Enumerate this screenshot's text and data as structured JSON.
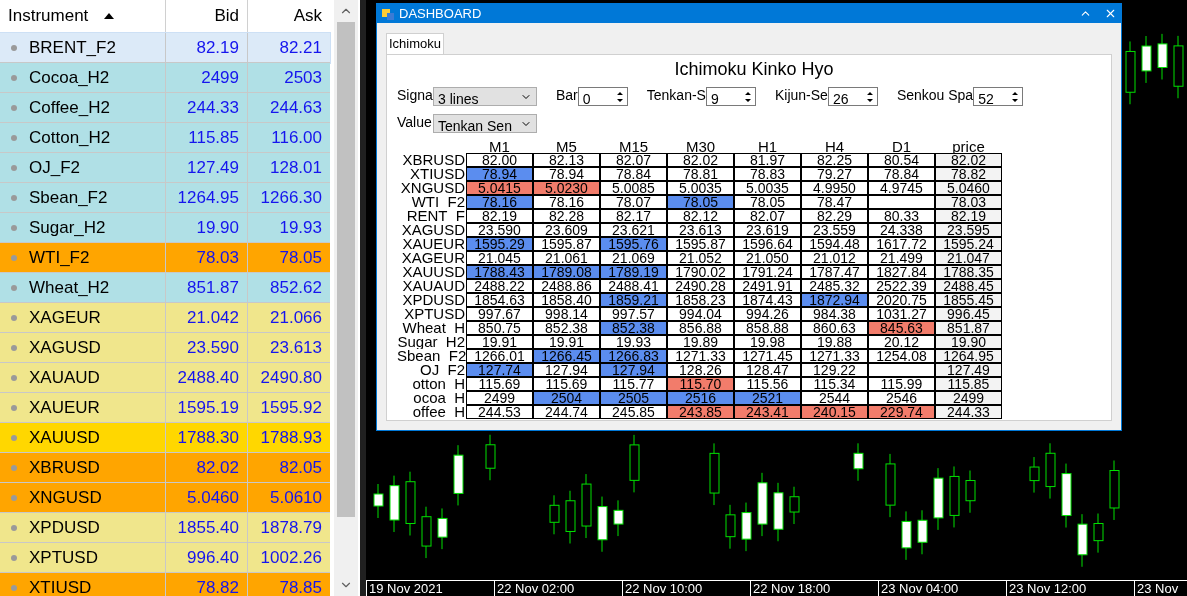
{
  "watchlist": {
    "columns": [
      "Instrument",
      "Bid",
      "Ask"
    ],
    "rows": [
      {
        "name": "BRENT_F2",
        "bid": "82.19",
        "ask": "82.21",
        "color": "#dceaf8",
        "selected": true
      },
      {
        "name": "Cocoa_H2",
        "bid": "2499",
        "ask": "2503",
        "color": "#b0e0e6",
        "selected": false
      },
      {
        "name": "Coffee_H2",
        "bid": "244.33",
        "ask": "244.63",
        "color": "#b0e0e6",
        "selected": false
      },
      {
        "name": "Cotton_H2",
        "bid": "115.85",
        "ask": "116.00",
        "color": "#b0e0e6",
        "selected": false
      },
      {
        "name": "OJ_F2",
        "bid": "127.49",
        "ask": "128.01",
        "color": "#b0e0e6",
        "selected": false
      },
      {
        "name": "Sbean_F2",
        "bid": "1264.95",
        "ask": "1266.30",
        "color": "#b0e0e6",
        "selected": false
      },
      {
        "name": "Sugar_H2",
        "bid": "19.90",
        "ask": "19.93",
        "color": "#b0e0e6",
        "selected": false
      },
      {
        "name": "WTI_F2",
        "bid": "78.03",
        "ask": "78.05",
        "color": "#ffa500",
        "selected": false
      },
      {
        "name": "Wheat_H2",
        "bid": "851.87",
        "ask": "852.62",
        "color": "#b0e0e6",
        "selected": false
      },
      {
        "name": "XAGEUR",
        "bid": "21.042",
        "ask": "21.066",
        "color": "#f0e68c",
        "selected": false
      },
      {
        "name": "XAGUSD",
        "bid": "23.590",
        "ask": "23.613",
        "color": "#f0e68c",
        "selected": false
      },
      {
        "name": "XAUAUD",
        "bid": "2488.40",
        "ask": "2490.80",
        "color": "#f0e68c",
        "selected": false
      },
      {
        "name": "XAUEUR",
        "bid": "1595.19",
        "ask": "1595.92",
        "color": "#f0e68c",
        "selected": false
      },
      {
        "name": "XAUUSD",
        "bid": "1788.30",
        "ask": "1788.93",
        "color": "#ffd700",
        "selected": false
      },
      {
        "name": "XBRUSD",
        "bid": "82.02",
        "ask": "82.05",
        "color": "#ffa500",
        "selected": false
      },
      {
        "name": "XNGUSD",
        "bid": "5.0460",
        "ask": "5.0610",
        "color": "#ffa500",
        "selected": false
      },
      {
        "name": "XPDUSD",
        "bid": "1855.40",
        "ask": "1878.79",
        "color": "#f0e68c",
        "selected": false
      },
      {
        "name": "XPTUSD",
        "bid": "996.40",
        "ask": "1002.26",
        "color": "#f0e68c",
        "selected": false
      },
      {
        "name": "XTIUSD",
        "bid": "78.82",
        "ask": "78.85",
        "color": "#ffa500",
        "selected": false
      }
    ]
  },
  "chart": {
    "time_labels": [
      "19 Nov 2021",
      "22 Nov 02:00",
      "22 Nov 10:00",
      "22 Nov 18:00",
      "23 Nov 04:00",
      "23 Nov 12:00",
      "23 Nov"
    ]
  },
  "dashboard": {
    "title": "DASHBOARD",
    "tabs": [
      {
        "label": "Ichimoku",
        "selected": true
      }
    ],
    "heading": "Ichimoku Kinko Hyo",
    "control_rows": [
      {
        "controls": [
          {
            "kind": "dropdown",
            "label": "Signa",
            "value": "3 lines"
          },
          {
            "kind": "spinner",
            "label": "Bar",
            "value": "0"
          },
          {
            "kind": "spinner",
            "label": "Tenkan-S",
            "value": "9"
          },
          {
            "kind": "spinner",
            "label": "Kijun-Se",
            "value": "26"
          },
          {
            "kind": "spinner",
            "label": "Senkou Spa",
            "value": "52"
          }
        ]
      },
      {
        "controls": [
          {
            "kind": "dropdown",
            "label": "Value",
            "value": "Tenkan Sen"
          }
        ]
      }
    ],
    "table": {
      "columns": [
        "M1",
        "M5",
        "M15",
        "M30",
        "H1",
        "H4",
        "D1",
        "price"
      ],
      "rows": [
        {
          "name": "XBRUSD",
          "cells": [
            {
              "text": "82.00"
            },
            {
              "text": "82.13"
            },
            {
              "text": "82.07"
            },
            {
              "text": "82.02"
            },
            {
              "text": "81.97"
            },
            {
              "text": "82.25"
            },
            {
              "text": "80.54"
            },
            {
              "text": "82.02"
            }
          ]
        },
        {
          "name": "XTIUSD",
          "cells": [
            {
              "text": "78.94",
              "color": "#5b8def"
            },
            {
              "text": "78.94"
            },
            {
              "text": "78.84"
            },
            {
              "text": "78.81"
            },
            {
              "text": "78.83"
            },
            {
              "text": "79.27"
            },
            {
              "text": "78.84"
            },
            {
              "text": "78.82"
            }
          ]
        },
        {
          "name": "XNGUSD",
          "cells": [
            {
              "text": "5.0415",
              "color": "#f27c6b"
            },
            {
              "text": "5.0230",
              "color": "#f27c6b"
            },
            {
              "text": "5.0085"
            },
            {
              "text": "5.0035"
            },
            {
              "text": "5.0035"
            },
            {
              "text": "4.9950"
            },
            {
              "text": "4.9745"
            },
            {
              "text": "5.0460"
            }
          ]
        },
        {
          "name": "WTI_F2",
          "cells": [
            {
              "text": "78.16",
              "color": "#5b8def"
            },
            {
              "text": "78.16"
            },
            {
              "text": "78.07"
            },
            {
              "text": "78.05",
              "color": "#5b8def"
            },
            {
              "text": "78.05"
            },
            {
              "text": "78.47"
            },
            {
              "text": ""
            },
            {
              "text": "78.03"
            }
          ]
        },
        {
          "name": "RENT_F",
          "cells": [
            {
              "text": "82.19"
            },
            {
              "text": "82.28"
            },
            {
              "text": "82.17"
            },
            {
              "text": "82.12"
            },
            {
              "text": "82.07"
            },
            {
              "text": "82.29"
            },
            {
              "text": "80.33"
            },
            {
              "text": "82.19"
            }
          ]
        },
        {
          "name": "XAGUSD",
          "cells": [
            {
              "text": "23.590"
            },
            {
              "text": "23.609"
            },
            {
              "text": "23.621"
            },
            {
              "text": "23.613"
            },
            {
              "text": "23.619"
            },
            {
              "text": "23.559"
            },
            {
              "text": "24.338"
            },
            {
              "text": "23.595"
            }
          ]
        },
        {
          "name": "XAUEUR",
          "cells": [
            {
              "text": "1595.29",
              "color": "#5b8def"
            },
            {
              "text": "1595.87"
            },
            {
              "text": "1595.76",
              "color": "#5b8def"
            },
            {
              "text": "1595.87"
            },
            {
              "text": "1596.64"
            },
            {
              "text": "1594.48"
            },
            {
              "text": "1617.72"
            },
            {
              "text": "1595.24"
            }
          ]
        },
        {
          "name": "XAGEUR",
          "cells": [
            {
              "text": "21.045"
            },
            {
              "text": "21.061"
            },
            {
              "text": "21.069"
            },
            {
              "text": "21.052"
            },
            {
              "text": "21.050"
            },
            {
              "text": "21.012"
            },
            {
              "text": "21.499"
            },
            {
              "text": "21.047"
            }
          ]
        },
        {
          "name": "XAUUSD",
          "cells": [
            {
              "text": "1788.43",
              "color": "#5b8def"
            },
            {
              "text": "1789.08",
              "color": "#5b8def"
            },
            {
              "text": "1789.19",
              "color": "#5b8def"
            },
            {
              "text": "1790.02"
            },
            {
              "text": "1791.24"
            },
            {
              "text": "1787.47"
            },
            {
              "text": "1827.84"
            },
            {
              "text": "1788.35"
            }
          ]
        },
        {
          "name": "XAUAUD",
          "cells": [
            {
              "text": "2488.22"
            },
            {
              "text": "2488.86"
            },
            {
              "text": "2488.41"
            },
            {
              "text": "2490.28"
            },
            {
              "text": "2491.91"
            },
            {
              "text": "2485.32"
            },
            {
              "text": "2522.39"
            },
            {
              "text": "2488.45"
            }
          ]
        },
        {
          "name": "XPDUSD",
          "cells": [
            {
              "text": "1854.63"
            },
            {
              "text": "1858.40"
            },
            {
              "text": "1859.21",
              "color": "#5b8def"
            },
            {
              "text": "1858.23"
            },
            {
              "text": "1874.43"
            },
            {
              "text": "1872.94",
              "color": "#5b8def"
            },
            {
              "text": "2020.75"
            },
            {
              "text": "1855.45"
            }
          ]
        },
        {
          "name": "XPTUSD",
          "cells": [
            {
              "text": "997.67"
            },
            {
              "text": "998.14"
            },
            {
              "text": "997.57"
            },
            {
              "text": "994.04"
            },
            {
              "text": "994.26"
            },
            {
              "text": "984.38"
            },
            {
              "text": "1031.27"
            },
            {
              "text": "996.45"
            }
          ]
        },
        {
          "name": "Wheat_H",
          "cells": [
            {
              "text": "850.75"
            },
            {
              "text": "852.38"
            },
            {
              "text": "852.38",
              "color": "#5b8def"
            },
            {
              "text": "856.88"
            },
            {
              "text": "858.88"
            },
            {
              "text": "860.63"
            },
            {
              "text": "845.63",
              "color": "#f27c6b"
            },
            {
              "text": "851.87"
            }
          ]
        },
        {
          "name": "Sugar_H2",
          "cells": [
            {
              "text": "19.91"
            },
            {
              "text": "19.91"
            },
            {
              "text": "19.93"
            },
            {
              "text": "19.89"
            },
            {
              "text": "19.98"
            },
            {
              "text": "19.88"
            },
            {
              "text": "20.12"
            },
            {
              "text": "19.90"
            }
          ]
        },
        {
          "name": "Sbean_F2",
          "cells": [
            {
              "text": "1266.01"
            },
            {
              "text": "1266.45",
              "color": "#5b8def"
            },
            {
              "text": "1266.83",
              "color": "#5b8def"
            },
            {
              "text": "1271.33"
            },
            {
              "text": "1271.45"
            },
            {
              "text": "1271.33"
            },
            {
              "text": "1254.08"
            },
            {
              "text": "1264.95"
            }
          ]
        },
        {
          "name": "OJ_F2",
          "cells": [
            {
              "text": "127.74",
              "color": "#5b8def"
            },
            {
              "text": "127.94"
            },
            {
              "text": "127.94",
              "color": "#5b8def"
            },
            {
              "text": "128.26"
            },
            {
              "text": "128.47"
            },
            {
              "text": "129.22"
            },
            {
              "text": ""
            },
            {
              "text": "127.49"
            }
          ]
        },
        {
          "name": "otton_H",
          "cells": [
            {
              "text": "115.69"
            },
            {
              "text": "115.69"
            },
            {
              "text": "115.77"
            },
            {
              "text": "115.70",
              "color": "#f27c6b"
            },
            {
              "text": "115.56"
            },
            {
              "text": "115.34"
            },
            {
              "text": "115.99"
            },
            {
              "text": "115.85"
            }
          ]
        },
        {
          "name": "ocoa_H",
          "cells": [
            {
              "text": "2499"
            },
            {
              "text": "2504",
              "color": "#5b8def"
            },
            {
              "text": "2505",
              "color": "#5b8def"
            },
            {
              "text": "2516",
              "color": "#5b8def"
            },
            {
              "text": "2521",
              "color": "#5b8def"
            },
            {
              "text": "2544"
            },
            {
              "text": "2546"
            },
            {
              "text": "2499"
            }
          ]
        },
        {
          "name": "offee_H",
          "cells": [
            {
              "text": "244.53"
            },
            {
              "text": "244.74"
            },
            {
              "text": "245.85"
            },
            {
              "text": "243.85",
              "color": "#f27c6b"
            },
            {
              "text": "243.41",
              "color": "#f27c6b"
            },
            {
              "text": "240.15",
              "color": "#f27c6b"
            },
            {
              "text": "229.74",
              "color": "#f27c6b"
            },
            {
              "text": "244.33"
            }
          ]
        }
      ]
    }
  }
}
